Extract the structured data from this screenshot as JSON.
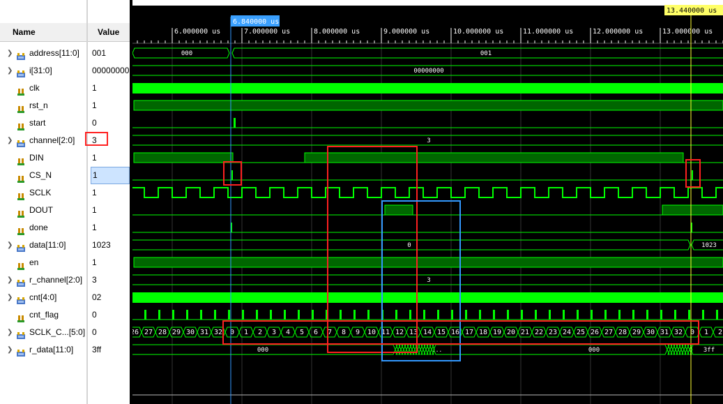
{
  "panel": {
    "name_header": "Name",
    "value_header": "Value"
  },
  "colors": {
    "wave": "#00ff00",
    "wave_fill": "#006600",
    "cursor_blue": "#3399ff",
    "cursor_yellow": "#ffff33",
    "box_red": "#ff2020",
    "box_blue": "#3399ff"
  },
  "signals": [
    {
      "name": "address[11:0]",
      "value": "001",
      "type": "bus",
      "expandable": true,
      "icon": "bus-icon"
    },
    {
      "name": "i[31:0]",
      "value": "00000000",
      "type": "bus",
      "expandable": true,
      "icon": "bus-icon"
    },
    {
      "name": "clk",
      "value": "1",
      "type": "bit",
      "expandable": false,
      "icon": "bit-icon"
    },
    {
      "name": "rst_n",
      "value": "1",
      "type": "bit",
      "expandable": false,
      "icon": "bit-icon"
    },
    {
      "name": "start",
      "value": "0",
      "type": "bit",
      "expandable": false,
      "icon": "bit-icon"
    },
    {
      "name": "channel[2:0]",
      "value": "3",
      "type": "bus",
      "expandable": true,
      "icon": "bus-icon"
    },
    {
      "name": "DIN",
      "value": "1",
      "type": "bit",
      "expandable": false,
      "icon": "bit-icon"
    },
    {
      "name": "CS_N",
      "value": "1",
      "type": "bit",
      "expandable": false,
      "icon": "bit-icon",
      "selected": true
    },
    {
      "name": "SCLK",
      "value": "1",
      "type": "bit",
      "expandable": false,
      "icon": "bit-icon"
    },
    {
      "name": "DOUT",
      "value": "1",
      "type": "bit",
      "expandable": false,
      "icon": "bit-icon"
    },
    {
      "name": "done",
      "value": "1",
      "type": "bit",
      "expandable": false,
      "icon": "bit-icon"
    },
    {
      "name": "data[11:0]",
      "value": "1023",
      "type": "bus",
      "expandable": true,
      "icon": "bus-icon"
    },
    {
      "name": "en",
      "value": "1",
      "type": "bit",
      "expandable": false,
      "icon": "bit-icon"
    },
    {
      "name": "r_channel[2:0]",
      "value": "3",
      "type": "bus",
      "expandable": true,
      "icon": "bus-icon"
    },
    {
      "name": "cnt[4:0]",
      "value": "02",
      "type": "bus",
      "expandable": true,
      "icon": "bus-icon"
    },
    {
      "name": "cnt_flag",
      "value": "0",
      "type": "bit",
      "expandable": false,
      "icon": "bit-icon"
    },
    {
      "name": "SCLK_C...[5:0]",
      "value": "0",
      "type": "bus",
      "expandable": true,
      "icon": "bus-icon"
    },
    {
      "name": "r_data[11:0]",
      "value": "3ff",
      "type": "bus",
      "expandable": true,
      "icon": "bus-icon"
    }
  ],
  "timeline": {
    "start_us": 5.43,
    "end_us": 13.9,
    "ticks": [
      "6.000000 us",
      "7.000000 us",
      "8.000000 us",
      "9.000000 us",
      "10.000000 us",
      "11.000000 us",
      "12.000000 us",
      "13.000000 us"
    ],
    "tick_values_us": [
      6,
      7,
      8,
      9,
      10,
      11,
      12,
      13
    ],
    "cursor_main": {
      "time_us": 6.84,
      "label": "6.840000 us"
    },
    "cursor_marker": {
      "time_us": 13.44,
      "label": "13.440000 us"
    }
  },
  "bus_labels": {
    "address": {
      "segments": [
        {
          "from": 5.43,
          "to": 6.84,
          "text": "000"
        },
        {
          "from": 6.84,
          "to": 13.9,
          "text": "001"
        }
      ]
    },
    "i": {
      "segments": [
        {
          "from": 5.43,
          "to": 13.9,
          "text": "00000000"
        }
      ]
    },
    "channel": {
      "segments": [
        {
          "from": 5.43,
          "to": 13.9,
          "text": "3"
        }
      ]
    },
    "data": {
      "segments": [
        {
          "from": 5.43,
          "to": 13.44,
          "text": "0"
        },
        {
          "from": 13.44,
          "to": 13.9,
          "text": "1023"
        }
      ]
    },
    "r_channel": {
      "segments": [
        {
          "from": 5.43,
          "to": 13.9,
          "text": "3"
        }
      ]
    },
    "sclk_counter": {
      "values": [
        "26",
        "27",
        "28",
        "29",
        "30",
        "31",
        "32",
        "0",
        "1",
        "2",
        "3",
        "4",
        "5",
        "6",
        "7",
        "8",
        "9",
        "10",
        "11",
        "12",
        "13",
        "14",
        "15",
        "16",
        "17",
        "18",
        "19",
        "20",
        "21",
        "22",
        "23",
        "24",
        "25",
        "26",
        "27",
        "28",
        "29",
        "30",
        "31",
        "32",
        "0",
        "1",
        "2"
      ]
    },
    "r_data": {
      "segments": [
        {
          "text": "000"
        },
        {
          "text": "..."
        },
        {
          "text": "000"
        },
        {
          "text": "3ff"
        }
      ]
    }
  }
}
